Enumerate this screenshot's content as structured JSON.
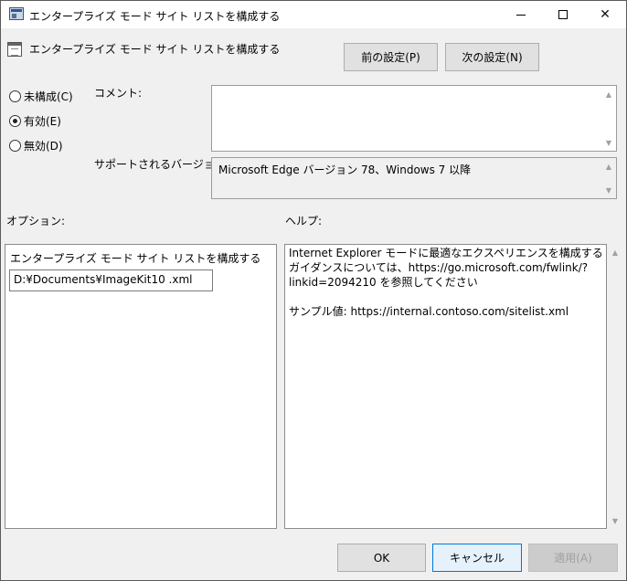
{
  "window": {
    "title": "エンタープライズ モード サイト リストを構成する"
  },
  "header": {
    "title": "エンタープライズ モード サイト リストを構成する",
    "prev_button": "前の設定(P)",
    "next_button": "次の設定(N)"
  },
  "state": {
    "options": [
      {
        "label": "未構成(C)",
        "checked": false
      },
      {
        "label": "有効(E)",
        "checked": true
      },
      {
        "label": "無効(D)",
        "checked": false
      }
    ]
  },
  "comment": {
    "label": "コメント:",
    "value": ""
  },
  "supported": {
    "label": "サポートされるバージョン:",
    "value": "Microsoft Edge バージョン 78、Windows 7 以降"
  },
  "options_section": {
    "label": "オプション:",
    "field_label": "エンタープライズ モード サイト リストを構成する",
    "field_value": "D:¥Documents¥ImageKit10 .xml"
  },
  "help_section": {
    "label": "ヘルプ:",
    "paragraph1": "Internet Explorer モードに最適なエクスペリエンスを構成するガイダンスについては、https://go.microsoft.com/fwlink/?linkid=2094210 を参照してください",
    "paragraph2": "サンプル値: https://internal.contoso.com/sitelist.xml"
  },
  "footer": {
    "ok": "OK",
    "cancel": "キャンセル",
    "apply": "適用(A)"
  }
}
